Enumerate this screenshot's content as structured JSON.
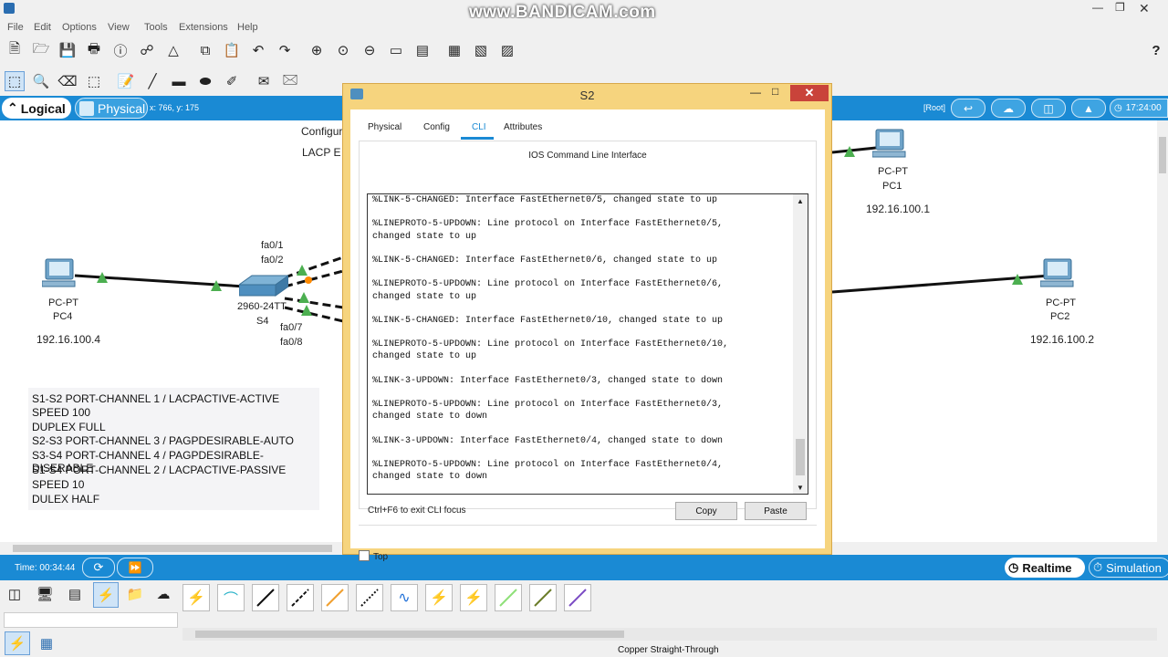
{
  "window": {
    "watermark": "www.BANDICAM.com",
    "minimize_icon": "minimize-icon",
    "restore_icon": "restore-icon",
    "close_icon": "close-icon"
  },
  "menu": [
    "File",
    "Edit",
    "Options",
    "View",
    "Tools",
    "Extensions",
    "Help"
  ],
  "workspace_tabs": {
    "logical": "Logical",
    "physical": "Physical"
  },
  "coords_text": "x: 766, y: 175",
  "root_label": "[Root]",
  "clock": "17:24:00",
  "topology": {
    "config_text": "Configur",
    "lacp_text": "LACP E",
    "pc4": {
      "model": "PC-PT",
      "name": "PC4",
      "ip": "192.16.100.4"
    },
    "pc1": {
      "model": "PC-PT",
      "name": "PC1",
      "ip": "192.16.100.1"
    },
    "pc2": {
      "model": "PC-PT",
      "name": "PC2",
      "ip": "192.16.100.2"
    },
    "s4": {
      "model": "2960-24TT",
      "name": "S4"
    },
    "ports": {
      "fa01": "fa0/1",
      "fa02": "fa0/2",
      "fa07": "fa0/7",
      "fa08": "fa0/8"
    }
  },
  "notes": [
    "S1-S2 PORT-CHANNEL 1 / LACPACTIVE-ACTIVE",
    "SPEED 100",
    "DUPLEX FULL",
    "S2-S3 PORT-CHANNEL 3 / PAGPDESIRABLE-AUTO",
    "S3-S4 PORT-CHANNEL 4 / PAGPDESIRABLE-DISERABLE",
    "S1-S4 PORT-CHANNEL 2 / LACPACTIVE-PASSIVE",
    "SPEED 10",
    "DULEX HALF"
  ],
  "dialog": {
    "title": "S2",
    "tabs": [
      "Physical",
      "Config",
      "CLI",
      "Attributes"
    ],
    "active_tab": "CLI",
    "heading": "IOS Command Line Interface",
    "cli_lines": [
      "%LINK-5-CHANGED: Interface FastEthernet0/5, changed state to up",
      "",
      "%LINEPROTO-5-UPDOWN: Line protocol on Interface FastEthernet0/5,",
      "changed state to up",
      "",
      "%LINK-5-CHANGED: Interface FastEthernet0/6, changed state to up",
      "",
      "%LINEPROTO-5-UPDOWN: Line protocol on Interface FastEthernet0/6,",
      "changed state to up",
      "",
      "%LINK-5-CHANGED: Interface FastEthernet0/10, changed state to up",
      "",
      "%LINEPROTO-5-UPDOWN: Line protocol on Interface FastEthernet0/10,",
      "changed state to up",
      "",
      "%LINK-3-UPDOWN: Interface FastEthernet0/3, changed state to down",
      "",
      "%LINEPROTO-5-UPDOWN: Line protocol on Interface FastEthernet0/3,",
      "changed state to down",
      "",
      "%LINK-3-UPDOWN: Interface FastEthernet0/4, changed state to down",
      "",
      "%LINEPROTO-5-UPDOWN: Line protocol on Interface FastEthernet0/4,",
      "changed state to down"
    ],
    "hint": "Ctrl+F6 to exit CLI focus",
    "copy_label": "Copy",
    "paste_label": "Paste",
    "top_label": "Top"
  },
  "bottom": {
    "time": "Time: 00:34:44",
    "realtime": "Realtime",
    "simulation": "Simulation",
    "status": "Copper Straight-Through"
  },
  "colors": {
    "accent": "#1a8ad4",
    "dialog_frame": "#f6d47e",
    "link_up": "#4caf50",
    "close_red": "#c9433a"
  }
}
